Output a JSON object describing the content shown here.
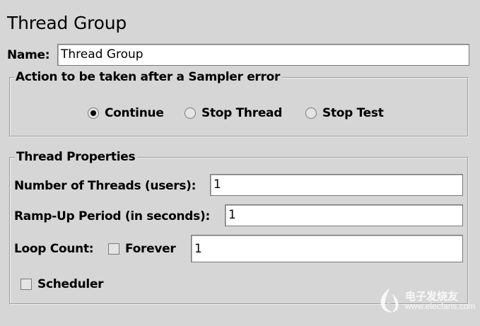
{
  "panel": {
    "title": "Thread Group",
    "name_label": "Name:",
    "name_value": "Thread Group"
  },
  "sampler_error": {
    "legend": "Action to be taken after a Sampler error",
    "options": [
      {
        "label": "Continue",
        "selected": true
      },
      {
        "label": "Stop Thread",
        "selected": false
      },
      {
        "label": "Stop Test",
        "selected": false
      }
    ]
  },
  "thread_properties": {
    "legend": "Thread Properties",
    "threads_label": "Number of Threads (users):",
    "threads_value": "1",
    "rampup_label": "Ramp-Up Period (in seconds):",
    "rampup_value": "1",
    "loop_label": "Loop Count:",
    "forever_label": "Forever",
    "forever_checked": false,
    "loop_value": "1",
    "scheduler_label": "Scheduler",
    "scheduler_checked": false
  },
  "watermark": {
    "text_cn": "电子发烧友",
    "url": "www.elecfans.com"
  }
}
